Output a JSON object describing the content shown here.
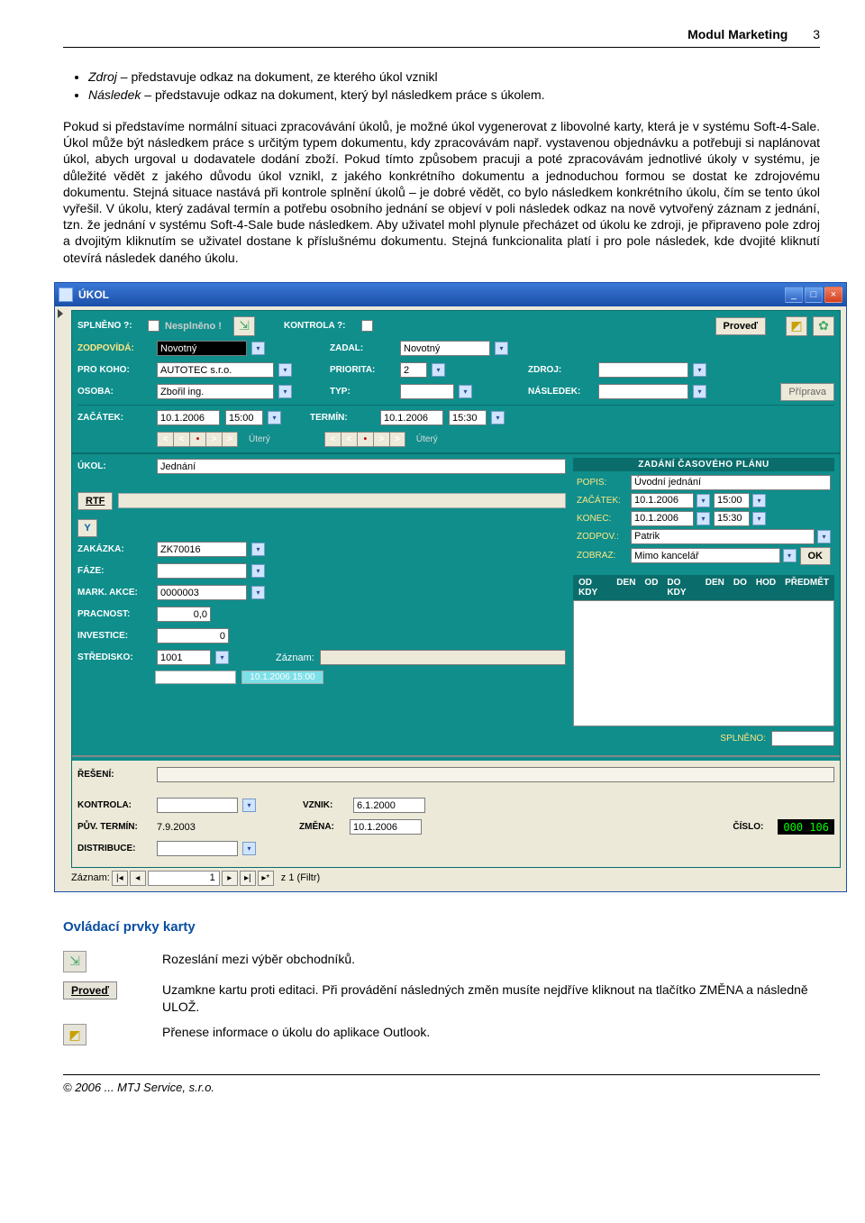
{
  "header": {
    "title": "Modul Marketing",
    "page": "3"
  },
  "bullets": [
    {
      "term": "Zdroj",
      "desc": "– představuje odkaz na dokument, ze kterého úkol vznikl"
    },
    {
      "term": "Následek",
      "desc": "– představuje odkaz na dokument, který byl následkem práce s úkolem."
    }
  ],
  "paragraph": "Pokud si představíme normální situaci zpracovávání úkolů, je možné úkol vygenerovat z libovolné karty, která je v systému Soft-4-Sale. Úkol může být následkem práce s určitým typem dokumentu, kdy zpracovávám např. vystavenou objednávku a potřebuji si naplánovat úkol, abych urgoval u dodavatele dodání zboží. Pokud tímto způsobem pracuji a poté zpracovávám jednotlivé úkoly v systému, je důležité vědět z jakého důvodu úkol vznikl, z jakého konkrétního dokumentu a jednoduchou formou se dostat ke zdrojovému dokumentu. Stejná situace nastává při kontrole splnění úkolů – je dobré vědět, co bylo následkem konkrétního úkolu, čím se tento úkol vyřešil. V úkolu, který zadával termín a potřebu osobního jednání se objeví v poli následek odkaz na nově vytvořený záznam z jednání, tzn. že jednání v systému Soft-4-Sale bude následkem. Aby uživatel mohl plynule přecházet od úkolu ke zdroji, je připraveno pole zdroj a dvojitým kliknutím se uživatel dostane k příslušnému dokumentu. Stejná funkcionalita platí i pro pole následek, kde dvojité kliknutí otevírá následek daného úkolu.",
  "section_title": "Ovládací prvky karty",
  "controls_desc": {
    "tree": "Rozeslání mezi výběr obchodníků.",
    "proved": "Uzamkne kartu proti editaci. Při provádění následných změn musíte nejdříve kliknout na tlačítko ZMĚNA a následně ULOŽ.",
    "outlook": "Přenese informace o úkolu do aplikace Outlook."
  },
  "controls_labels": {
    "proved": "Proveď"
  },
  "footer": "© 2006 ... MTJ Service, s.r.o.",
  "win": {
    "title": "ÚKOL",
    "top": {
      "splneno_label": "SPLNĚNO ?:",
      "nesplneno_label": "Nesplněno !",
      "kontrola_label": "KONTROLA ?:",
      "proved_btn": "Proveď",
      "zodpovida_label": "ZODPOVÍDÁ:",
      "zodpovida_val": "Novotný",
      "zadal_label": "ZADAL:",
      "zadal_val": "Novotný",
      "prokoho_label": "PRO KOHO:",
      "prokoho_val": "AUTOTEC s.r.o.",
      "priorita_label": "PRIORITA:",
      "priorita_val": "2",
      "zdroj_label": "ZDROJ:",
      "osoba_label": "OSOBA:",
      "osoba_val": "Zbořil ing.",
      "typ_label": "TYP:",
      "nasledek_label": "NÁSLEDEK:",
      "priprava_btn": "Příprava",
      "zacatek_label": "ZAČÁTEK:",
      "zacatek_date": "10.1.2006",
      "zacatek_time": "15:00",
      "termin_label": "TERMÍN:",
      "termin_date": "10.1.2006",
      "termin_time": "15:30",
      "day1": "Úterý",
      "day2": "Úterý",
      "nav": [
        "<",
        "<",
        "•",
        ">",
        ">"
      ]
    },
    "mid": {
      "ukol_label": "ÚKOL:",
      "ukol_val": "Jednání",
      "rtf_btn": "RTF",
      "filter_icon": "Y",
      "zakazka_label": "ZAKÁZKA:",
      "zakazka_val": "ZK70016",
      "faze_label": "FÁZE:",
      "mark_label": "MARK. AKCE:",
      "mark_val": "0000003",
      "pracnost_label": "PRACNOST:",
      "pracnost_val": "0,0",
      "investice_label": "INVESTICE:",
      "investice_val": "0",
      "stredisko_label": "STŘEDISKO:",
      "stredisko_val": "1001",
      "zaznam_label": "Záznam:",
      "gridcols": [
        "OD KDY",
        "DEN",
        "OD",
        "DO KDY",
        "DEN",
        "DO",
        "HOD",
        "PŘEDMĚT"
      ],
      "ts1": "10.1.2006 15:00",
      "ts2": "10.1.2006 15:00",
      "splneno_label": "SPLNĚNO:"
    },
    "plan": {
      "head": "ZADÁNÍ ČASOVÉHO PLÁNU",
      "popis_label": "POPIS:",
      "popis_val": "Úvodní jednání",
      "zacatek_label": "ZAČÁTEK:",
      "zacatek_date": "10.1.2006",
      "zacatek_time": "15:00",
      "konec_label": "KONEC:",
      "konec_date": "10.1.2006",
      "konec_time": "15:30",
      "zodpov_label": "ZODPOV.:",
      "zodpov_val": "Patrik",
      "zobraz_label": "ZOBRAZ:",
      "zobraz_val": "Mimo kancelář",
      "ok_btn": "OK"
    },
    "bottom": {
      "reseni_label": "ŘEŠENÍ:",
      "kontrola_label": "KONTROLA:",
      "vznik_label": "VZNIK:",
      "vznik_val": "6.1.2000",
      "puv_label": "PŮV. TERMÍN:",
      "puv_val": "7.9.2003",
      "zmena_label": "ZMĚNA:",
      "zmena_val": "10.1.2006",
      "cislo_label": "ČÍSLO:",
      "cislo_val": "000 106",
      "distribuce_label": "DISTRIBUCE:"
    },
    "recnav": {
      "label": "Záznam:",
      "value": "1",
      "suffix": "z 1 (Filtr)"
    }
  }
}
